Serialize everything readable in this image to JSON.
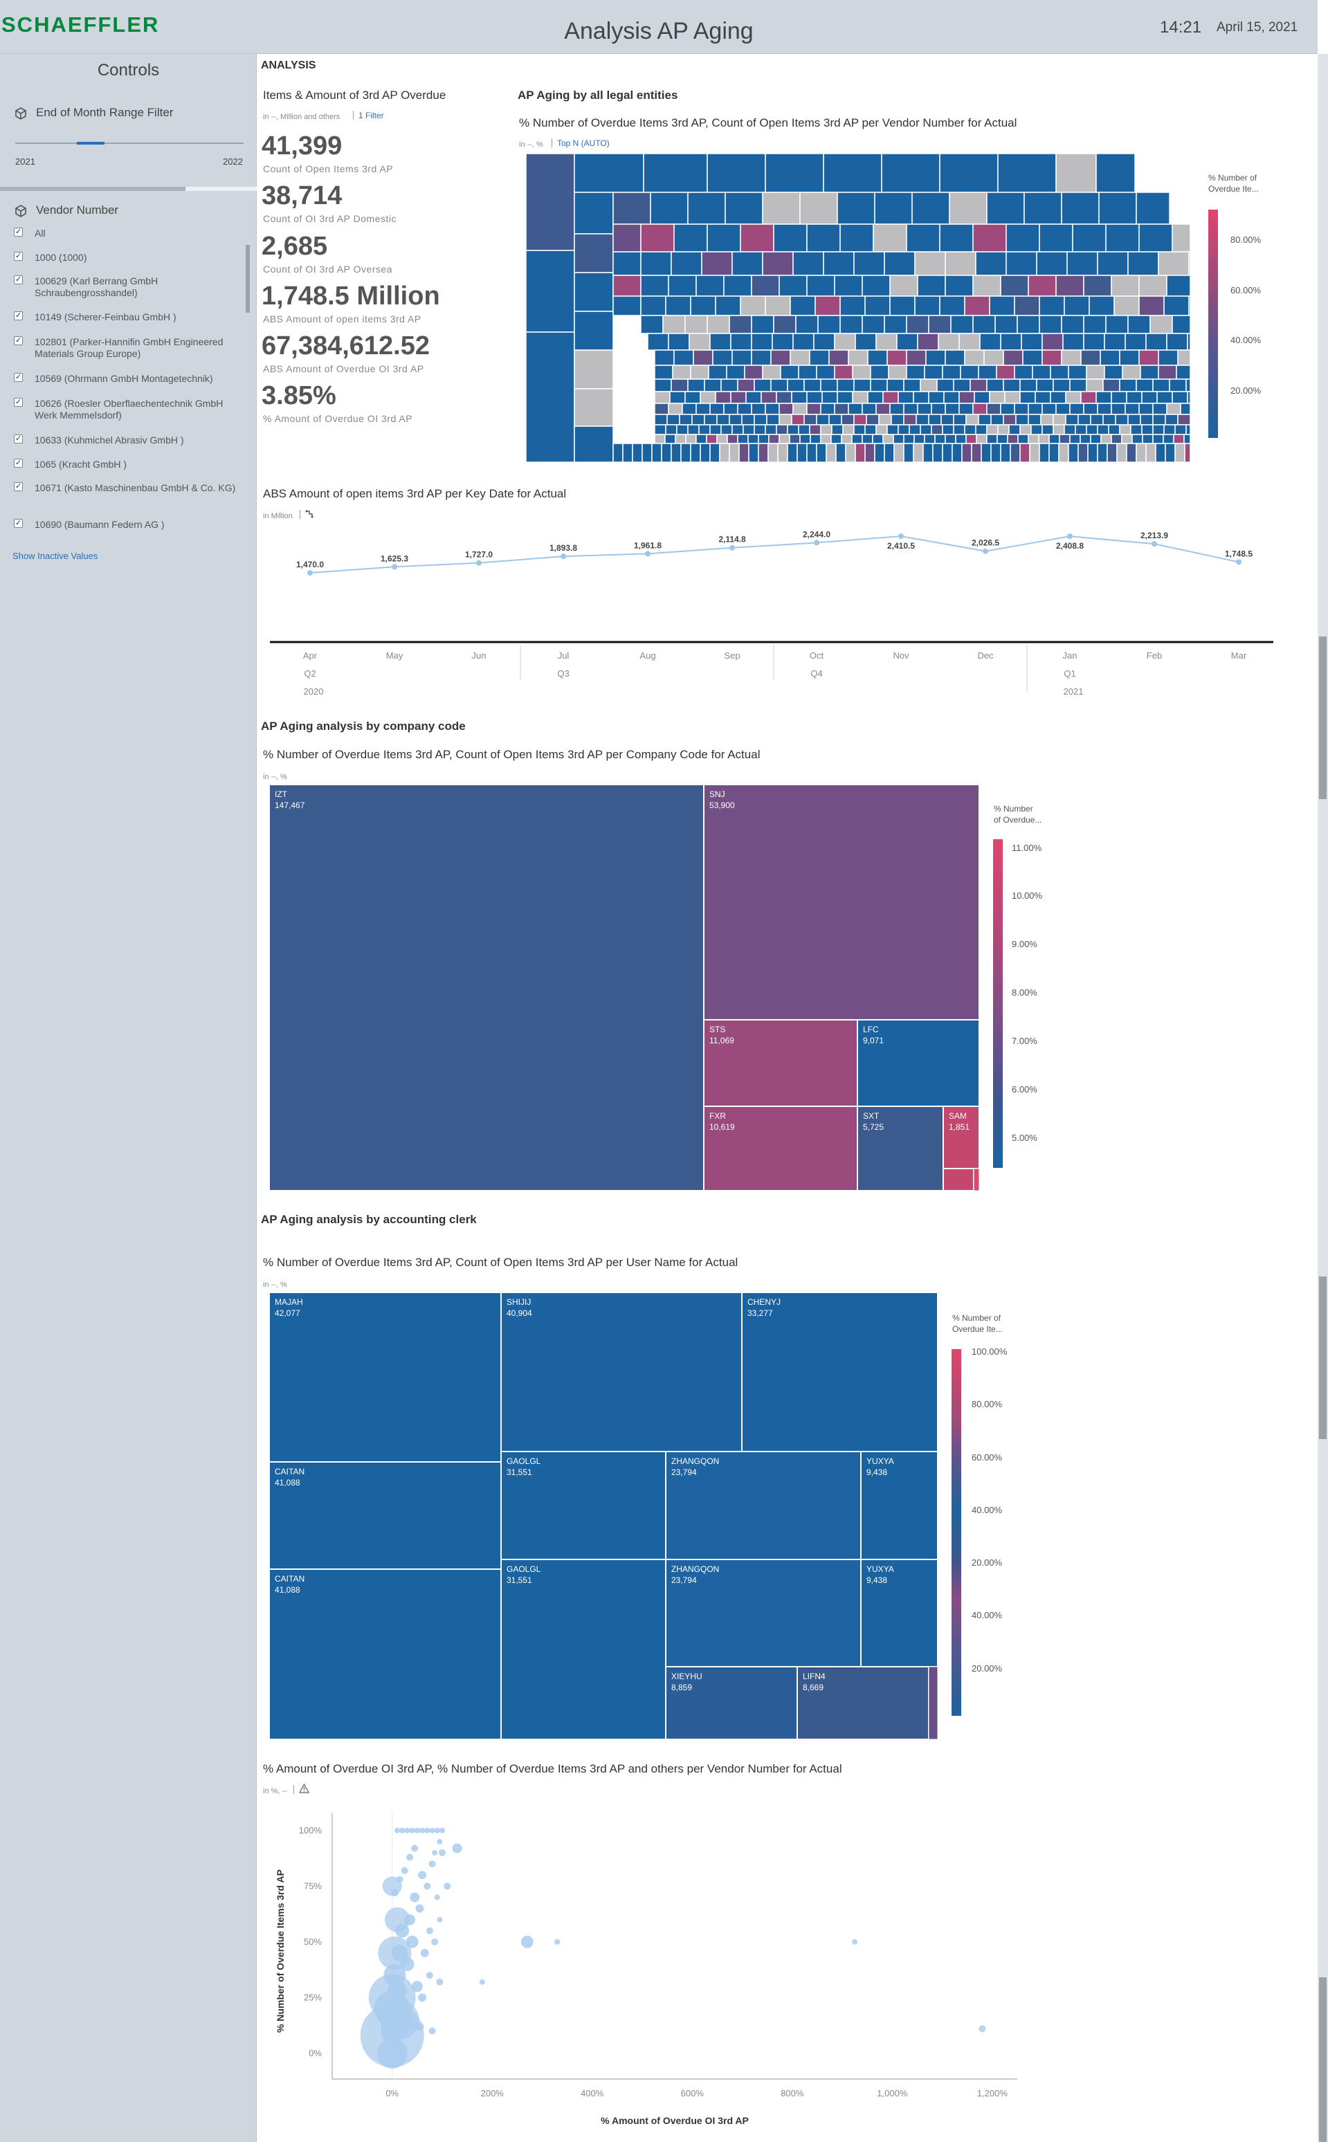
{
  "header": {
    "logo": "SCHAEFFLER",
    "title": "Analysis AP Aging",
    "time": "14:21",
    "date": "April 15, 2021"
  },
  "sidebar": {
    "title": "Controls",
    "range_filter": {
      "label": "End of Month Range Filter",
      "min_label": "2021",
      "max_label": "2022",
      "selected_from": 0.27,
      "selected_to": 0.39
    },
    "vendor_filter": {
      "label": "Vendor Number",
      "items": [
        {
          "label": "All"
        },
        {
          "label": "1000 (1000)"
        },
        {
          "label": "100629 (Karl Berrang GmbH Schraubengrosshandel)"
        },
        {
          "label": "10149 (Scherer-Feinbau GmbH )"
        },
        {
          "label": "102801 (Parker-Hannifin GmbH Engineered Materials Group Europe)"
        },
        {
          "label": "10569 (Ohrmann GmbH Montagetechnik)"
        },
        {
          "label": "10626 (Roesler Oberflaechentechnik GmbH Werk Memmelsdorf)"
        },
        {
          "label": "10633 (Kuhmichel Abrasiv GmbH )"
        },
        {
          "label": "1065 (Kracht GmbH )"
        },
        {
          "label": "10671 (Kasto Maschinenbau GmbH & Co. KG)"
        },
        {
          "label": "10690 (Baumann Federn AG )"
        }
      ],
      "show_inactive": "Show Inactive Values"
    }
  },
  "main": {
    "section_label": "ANALYSIS",
    "kpi_panel": {
      "title": "Items & Amount of 3rd AP Overdue",
      "units": "in --, Million and others",
      "filter_link": "1 Filter",
      "kpis": [
        {
          "value": "41,399",
          "label": "Count of Open Items 3rd AP"
        },
        {
          "value": "38,714",
          "label": "Count of OI 3rd AP Domestic"
        },
        {
          "value": "2,685",
          "label": "Count of OI 3rd AP Oversea"
        },
        {
          "value": "1,748.5 Million",
          "label": "ABS Amount of open items 3rd AP"
        },
        {
          "value": "67,384,612.52",
          "label": "ABS Amount of Overdue OI 3rd AP"
        },
        {
          "value": "3.85%",
          "label": "% Amount of Overdue OI 3rd AP"
        }
      ]
    },
    "vendor_treemap": {
      "section": "AP Aging by all legal entities",
      "title": "% Number of Overdue Items 3rd AP, Count of Open Items 3rd AP per Vendor Number for Actual",
      "units": "in --, %",
      "topn": "Top N (AUTO)",
      "legend_title_1": "% Number of",
      "legend_title_2": "Overdue Ite...",
      "legend_ticks": [
        "80.00%",
        "60.00%",
        "40.00%",
        "20.00%"
      ]
    },
    "line_chart": {
      "title": "ABS Amount of open items 3rd AP per Key Date for Actual",
      "units": "in Million"
    },
    "company_treemap": {
      "section": "AP Aging analysis by company code",
      "title": "% Number of Overdue Items 3rd AP, Count of Open Items 3rd AP per Company Code for Actual",
      "units": "in --, %",
      "legend_title_1": "% Number",
      "legend_title_2": "of Overdue...",
      "legend_ticks": [
        "11.00%",
        "10.00%",
        "9.00%",
        "8.00%",
        "7.00%",
        "6.00%",
        "5.00%"
      ]
    },
    "clerk_treemap": {
      "section": "AP Aging analysis by accounting clerk",
      "title": "% Number of Overdue Items 3rd AP, Count of Open Items 3rd AP per User Name for Actual",
      "units": "in --, %",
      "legend_title_1": "% Number of",
      "legend_title_2": "Overdue Ite...",
      "legend_ticks": [
        "100.00%",
        "80.00%",
        "60.00%",
        "40.00%",
        "20.00%",
        "40.00%",
        "20.00%"
      ]
    },
    "scatter": {
      "title": "% Amount of Overdue OI 3rd AP, % Number of Overdue Items 3rd AP and others per Vendor Number for Actual",
      "units": "in %, --"
    }
  },
  "chart_data": [
    {
      "type": "line",
      "title": "ABS Amount of open items 3rd AP per Key Date for Actual",
      "x": [
        "Apr",
        "May",
        "Jun",
        "Jul",
        "Aug",
        "Sep",
        "Oct",
        "Nov",
        "Dec",
        "Jan",
        "Feb",
        "Mar"
      ],
      "x_groups": [
        {
          "label": "Q2",
          "year": "2020",
          "months": [
            "Apr",
            "May",
            "Jun"
          ]
        },
        {
          "label": "Q3",
          "months": [
            "Jul",
            "Aug",
            "Sep"
          ]
        },
        {
          "label": "Q4",
          "months": [
            "Oct",
            "Nov",
            "Dec"
          ]
        },
        {
          "label": "Q1",
          "year": "2021",
          "months": [
            "Jan",
            "Feb",
            "Mar"
          ]
        }
      ],
      "series": [
        {
          "values": [
            1470.0,
            1625.3,
            1727.0,
            1893.8,
            1961.8,
            2114.8,
            2244.0,
            2410.5,
            2026.5,
            2408.8,
            2213.9,
            1748.5
          ]
        }
      ],
      "data_labels": [
        "1,470.0",
        "1,625.3",
        "1,727.0",
        "1,893.8",
        "1,961.8",
        "2,114.8",
        "2,244.0",
        "2,410.5",
        "2,026.5",
        "2,408.8",
        "2,213.9",
        "1,748.5"
      ],
      "ylim": [
        0,
        2600
      ],
      "color": "#9ec5ea"
    },
    {
      "type": "treemap",
      "title": "% Number of Overdue Items 3rd AP, Count of Open Items 3rd AP per Company Code for Actual",
      "items": [
        {
          "label": "IZT",
          "value_label": "147,467",
          "count": 147467,
          "pct": 6.0
        },
        {
          "label": "SNJ",
          "value_label": "53,900",
          "count": 53900,
          "pct": 8.0
        },
        {
          "label": "STS",
          "value_label": "11,069",
          "count": 11069,
          "pct": 9.6
        },
        {
          "label": "LFC",
          "value_label": "9,071",
          "count": 9071,
          "pct": 5.0
        },
        {
          "label": "FXR",
          "value_label": "10,619",
          "count": 10619,
          "pct": 9.3
        },
        {
          "label": "SXT",
          "value_label": "5,725",
          "count": 5725,
          "pct": 6.2
        },
        {
          "label": "SAM",
          "value_label": "1,851",
          "count": 1851,
          "pct": 10.3
        }
      ]
    },
    {
      "type": "treemap",
      "title": "% Number of Overdue Items 3rd AP, Count of Open Items 3rd AP per User Name for Actual",
      "items": [
        {
          "label": "MAJAH",
          "value_label": "42,077"
        },
        {
          "label": "SHIJIJ",
          "value_label": "40,904"
        },
        {
          "label": "CHENYJ",
          "value_label": "33,277"
        },
        {
          "label": "CAITAN",
          "value_label": "41,088"
        },
        {
          "label": "GAOLGL",
          "value_label": "31,551"
        },
        {
          "label": "ZHANGQON",
          "value_label": "23,794"
        },
        {
          "label": "YUXYA",
          "value_label": "9,438"
        },
        {
          "label": "CAITAN",
          "value_label": "41,088"
        },
        {
          "label": "GAOLGL",
          "value_label": "31,551"
        },
        {
          "label": "ZHANGQON",
          "value_label": "23,794"
        },
        {
          "label": "YUXYA",
          "value_label": "9,438"
        },
        {
          "label": "XIEYHU",
          "value_label": "8,859"
        },
        {
          "label": "LIFN4",
          "value_label": "8,669"
        }
      ]
    },
    {
      "type": "scatter",
      "title": "% Amount of Overdue OI 3rd AP, % Number of Overdue Items 3rd AP and others per Vendor Number for Actual",
      "xlabel": "% Amount of Overdue OI 3rd AP",
      "ylabel": "% Number of Overdue Items 3rd AP",
      "x_ticks": [
        "0%",
        "200%",
        "400%",
        "600%",
        "800%",
        "1,000%",
        "1,200%"
      ],
      "y_ticks": [
        "0%",
        "25%",
        "50%",
        "75%",
        "100%"
      ],
      "xlim": [
        -120,
        1250
      ],
      "ylim": [
        -10,
        108
      ],
      "color": "#a9cbee",
      "points": [
        {
          "x": 0,
          "y": 0,
          "r": 22
        },
        {
          "x": 0,
          "y": 20,
          "r": 26
        },
        {
          "x": 2,
          "y": 10,
          "r": 18
        },
        {
          "x": 5,
          "y": 35,
          "r": 16
        },
        {
          "x": 10,
          "y": 28,
          "r": 14
        },
        {
          "x": 15,
          "y": 45,
          "r": 12
        },
        {
          "x": 20,
          "y": 55,
          "r": 10
        },
        {
          "x": 25,
          "y": 15,
          "r": 12
        },
        {
          "x": 30,
          "y": 40,
          "r": 10
        },
        {
          "x": 35,
          "y": 60,
          "r": 8
        },
        {
          "x": 40,
          "y": 50,
          "r": 9
        },
        {
          "x": 45,
          "y": 70,
          "r": 7
        },
        {
          "x": 50,
          "y": 30,
          "r": 8
        },
        {
          "x": 55,
          "y": 65,
          "r": 6
        },
        {
          "x": 60,
          "y": 80,
          "r": 6
        },
        {
          "x": 65,
          "y": 45,
          "r": 6
        },
        {
          "x": 70,
          "y": 75,
          "r": 5
        },
        {
          "x": 75,
          "y": 55,
          "r": 5
        },
        {
          "x": 80,
          "y": 85,
          "r": 5
        },
        {
          "x": 85,
          "y": 90,
          "r": 4
        },
        {
          "x": 90,
          "y": 70,
          "r": 4
        },
        {
          "x": 95,
          "y": 60,
          "r": 4
        },
        {
          "x": 100,
          "y": 100,
          "r": 4
        },
        {
          "x": 10,
          "y": 100,
          "r": 4
        },
        {
          "x": 20,
          "y": 100,
          "r": 4
        },
        {
          "x": 30,
          "y": 100,
          "r": 4
        },
        {
          "x": 40,
          "y": 100,
          "r": 4
        },
        {
          "x": 50,
          "y": 100,
          "r": 4
        },
        {
          "x": 60,
          "y": 100,
          "r": 4
        },
        {
          "x": 70,
          "y": 100,
          "r": 4
        },
        {
          "x": 80,
          "y": 100,
          "r": 4
        },
        {
          "x": 90,
          "y": 100,
          "r": 4
        },
        {
          "x": 95,
          "y": 95,
          "r": 4
        },
        {
          "x": 100,
          "y": 90,
          "r": 5
        },
        {
          "x": 110,
          "y": 75,
          "r": 5
        },
        {
          "x": 85,
          "y": 50,
          "r": 5
        },
        {
          "x": 75,
          "y": 35,
          "r": 5
        },
        {
          "x": 60,
          "y": 25,
          "r": 6
        },
        {
          "x": 55,
          "y": 12,
          "r": 6
        },
        {
          "x": 95,
          "y": 32,
          "r": 5
        },
        {
          "x": 80,
          "y": 10,
          "r": 5
        },
        {
          "x": 45,
          "y": 92,
          "r": 5
        },
        {
          "x": 35,
          "y": 88,
          "r": 5
        },
        {
          "x": 25,
          "y": 82,
          "r": 5
        },
        {
          "x": 15,
          "y": 78,
          "r": 5
        },
        {
          "x": 5,
          "y": 72,
          "r": 5
        },
        {
          "x": 130,
          "y": 92,
          "r": 7
        },
        {
          "x": 180,
          "y": 32,
          "r": 4
        },
        {
          "x": 270,
          "y": 50,
          "r": 9
        },
        {
          "x": 330,
          "y": 50,
          "r": 4
        },
        {
          "x": 925,
          "y": 50,
          "r": 4
        },
        {
          "x": 1180,
          "y": 11,
          "r": 5
        }
      ]
    }
  ]
}
